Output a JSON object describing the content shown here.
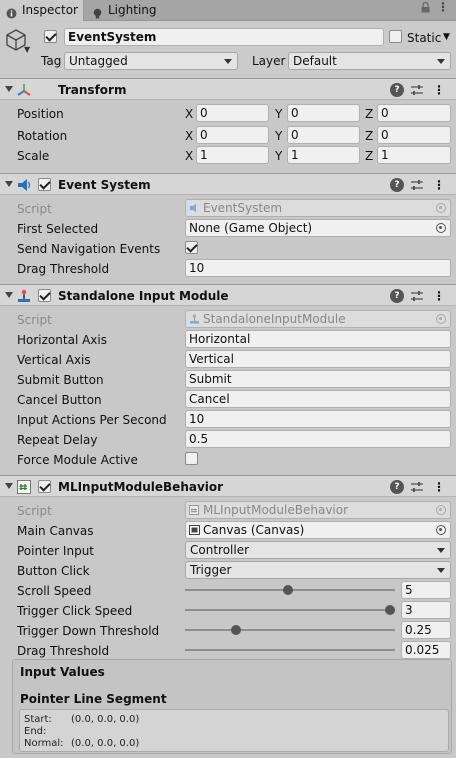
{
  "tabs": [
    {
      "label": "Inspector",
      "icon": "info-icon"
    },
    {
      "label": "Lighting",
      "icon": "bulb-icon"
    }
  ],
  "gameobject": {
    "name": "EventSystem",
    "active": true,
    "static_label": "Static",
    "static_checked": false,
    "tag_label": "Tag",
    "tag_value": "Untagged",
    "layer_label": "Layer",
    "layer_value": "Default"
  },
  "transform": {
    "title": "Transform",
    "position_label": "Position",
    "rotation_label": "Rotation",
    "scale_label": "Scale",
    "axis_x": "X",
    "axis_y": "Y",
    "axis_z": "Z",
    "position": {
      "x": "0",
      "y": "0",
      "z": "0"
    },
    "rotation": {
      "x": "0",
      "y": "0",
      "z": "0"
    },
    "scale": {
      "x": "1",
      "y": "1",
      "z": "1"
    }
  },
  "event_system": {
    "title": "Event System",
    "enabled": true,
    "script_label": "Script",
    "script_value": "EventSystem",
    "first_selected_label": "First Selected",
    "first_selected_value": "None (Game Object)",
    "send_nav_label": "Send Navigation Events",
    "send_nav_checked": true,
    "drag_threshold_label": "Drag Threshold",
    "drag_threshold_value": "10"
  },
  "standalone": {
    "title": "Standalone Input Module",
    "enabled": true,
    "script_label": "Script",
    "script_value": "StandaloneInputModule",
    "rows": [
      {
        "label": "Horizontal Axis",
        "value": "Horizontal"
      },
      {
        "label": "Vertical Axis",
        "value": "Vertical"
      },
      {
        "label": "Submit Button",
        "value": "Submit"
      },
      {
        "label": "Cancel Button",
        "value": "Cancel"
      },
      {
        "label": "Input Actions Per Second",
        "value": "10"
      },
      {
        "label": "Repeat Delay",
        "value": "0.5"
      }
    ],
    "force_label": "Force Module Active",
    "force_checked": false
  },
  "ml": {
    "title": "MLInputModuleBehavior",
    "enabled": true,
    "script_label": "Script",
    "script_value": "MLInputModuleBehavior",
    "main_canvas_label": "Main Canvas",
    "main_canvas_value": "Canvas (Canvas)",
    "pointer_input_label": "Pointer Input",
    "pointer_input_value": "Controller",
    "button_click_label": "Button Click",
    "button_click_value": "Trigger",
    "sliders": [
      {
        "label": "Scroll Speed",
        "value": "5",
        "fraction": 0.5
      },
      {
        "label": "Trigger Click Speed",
        "value": "3",
        "fraction": 1.0
      },
      {
        "label": "Trigger Down Threshold",
        "value": "0.25",
        "fraction": 0.25
      },
      {
        "label": "Drag Threshold",
        "value": "0.025",
        "fraction": null
      }
    ],
    "input_values_title": "Input Values",
    "pointer_line_title": "Pointer Line Segment",
    "segment": [
      {
        "label": "Start:",
        "value": "(0.0, 0.0, 0.0)"
      },
      {
        "label": "End:",
        "value": ""
      },
      {
        "label": "Normal:",
        "value": "(0.0, 0.0, 0.0)"
      }
    ]
  },
  "colors": {
    "transform_icon_red": "#d9534f",
    "transform_icon_green": "#5cb85c",
    "transform_icon_blue": "#3a7bd5",
    "event_icon_blue": "#2a6fb8"
  }
}
